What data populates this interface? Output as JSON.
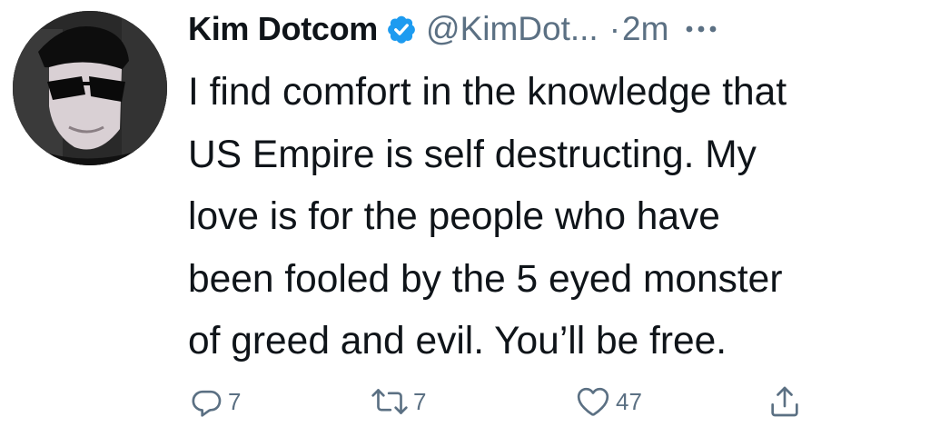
{
  "tweet": {
    "author_name": "Kim Dotcom",
    "handle": "@KimDot...",
    "separator": "·",
    "time": "2m",
    "verified": true,
    "avatar_icon": "profile-photo",
    "more_icon": "more-horizontal-icon",
    "text_lines": [
      "I find comfort in the knowledge that",
      "US Empire is self destructing. My",
      "love is for the people who have",
      "been fooled by the 5 eyed monster",
      "of greed and evil. You’ll be free."
    ]
  },
  "actions": {
    "reply": {
      "icon": "reply-icon",
      "count": "7"
    },
    "retweet": {
      "icon": "retweet-icon",
      "count": "7"
    },
    "like": {
      "icon": "heart-icon",
      "count": "47"
    },
    "share": {
      "icon": "share-icon"
    }
  },
  "colors": {
    "text": "#0f1419",
    "secondary": "#5b7083",
    "verified": "#1d9bf0",
    "background": "#ffffff"
  }
}
